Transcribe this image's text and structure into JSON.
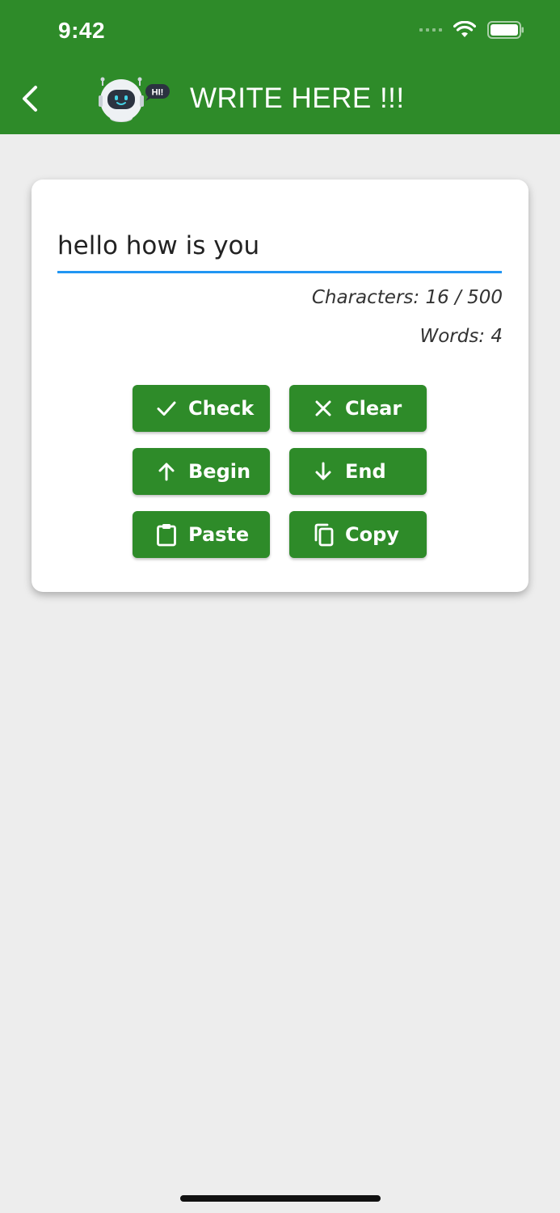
{
  "status_bar": {
    "time": "9:42"
  },
  "header": {
    "title": "WRITE HERE !!!",
    "logo_badge": "HI!"
  },
  "editor": {
    "text": "hello how is you",
    "characters_label": "Characters: 16 / 500",
    "words_label": "Words: 4"
  },
  "buttons": {
    "check": "Check",
    "clear": "Clear",
    "begin": "Begin",
    "end": "End",
    "paste": "Paste",
    "copy": "Copy"
  },
  "colors": {
    "primary": "#2e8b29",
    "background": "#ededed",
    "input_underline": "#2196f3"
  }
}
